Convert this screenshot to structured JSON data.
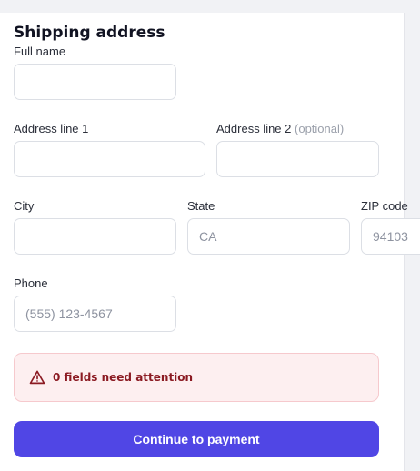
{
  "form": {
    "title": "Shipping address",
    "full_name": {
      "label": "Full name",
      "value": "",
      "placeholder": ""
    },
    "address1": {
      "label": "Address line 1",
      "value": "",
      "placeholder": ""
    },
    "address2": {
      "label": "Address line 2",
      "optional_hint": "(optional)",
      "value": "",
      "placeholder": ""
    },
    "city": {
      "label": "City",
      "value": "",
      "placeholder": ""
    },
    "state": {
      "label": "State",
      "value": "",
      "placeholder": "CA"
    },
    "zip": {
      "label": "ZIP code",
      "value": "",
      "placeholder": "94103"
    },
    "phone": {
      "label": "Phone",
      "value": "",
      "placeholder": "(555) 123-4567"
    }
  },
  "alert": {
    "icon": "warning-triangle-icon",
    "count": "0",
    "message": "fields need attention",
    "color": "#8b1a22"
  },
  "actions": {
    "continue_label": "Continue to payment",
    "accent": "#5046e5"
  }
}
